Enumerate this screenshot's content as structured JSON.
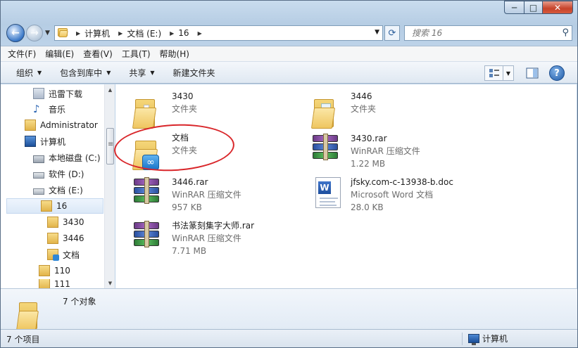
{
  "window": {
    "minimize": "─",
    "maximize": "□",
    "close": "✕"
  },
  "nav": {
    "back": "←",
    "forward": "→",
    "address": [
      "计算机",
      "文档 (E:)",
      "16"
    ],
    "search_placeholder": "搜索 16"
  },
  "menu": [
    "文件(F)",
    "编辑(E)",
    "查看(V)",
    "工具(T)",
    "帮助(H)"
  ],
  "commands": {
    "organize": "组织",
    "include_library": "包含到库中",
    "share": "共享",
    "new_folder": "新建文件夹",
    "help": "?"
  },
  "tree": [
    {
      "label": "迅雷下载",
      "icon": "download-icon"
    },
    {
      "label": "音乐",
      "icon": "music-icon"
    },
    {
      "label": "Administrator",
      "icon": "user-folder-icon"
    },
    {
      "label": "计算机",
      "icon": "computer-icon"
    },
    {
      "label": "本地磁盘 (C:)",
      "icon": "system-drive-icon"
    },
    {
      "label": "软件 (D:)",
      "icon": "drive-icon"
    },
    {
      "label": "文档 (E:)",
      "icon": "drive-icon"
    },
    {
      "label": "16",
      "icon": "folder-icon"
    },
    {
      "label": "3430",
      "icon": "folder-icon"
    },
    {
      "label": "3446",
      "icon": "folder-icon"
    },
    {
      "label": "文档",
      "icon": "cloud-folder-icon"
    },
    {
      "label": "110",
      "icon": "folder-icon"
    },
    {
      "label": "111",
      "icon": "folder-icon"
    }
  ],
  "files": [
    {
      "name": "3430",
      "line2": "文件夹",
      "line3": "",
      "icon": "folder-icon"
    },
    {
      "name": "3446",
      "line2": "文件夹",
      "line3": "",
      "icon": "folder-icon"
    },
    {
      "name": "文档",
      "line2": "文件夹",
      "line3": "",
      "icon": "cloud-folder-icon"
    },
    {
      "name": "3430.rar",
      "line2": "WinRAR 压缩文件",
      "line3": "1.22 MB",
      "icon": "winrar-icon"
    },
    {
      "name": "3446.rar",
      "line2": "WinRAR 压缩文件",
      "line3": "957 KB",
      "icon": "winrar-icon"
    },
    {
      "name": "jfsky.com-c-13938-b.doc",
      "line2": "Microsoft Word 文档",
      "line3": "28.0 KB",
      "icon": "word-doc-icon"
    },
    {
      "name": "书法篆刻集字大师.rar",
      "line2": "WinRAR 压缩文件",
      "line3": "7.71 MB",
      "icon": "winrar-icon"
    }
  ],
  "details": {
    "count": "7 个对象"
  },
  "status": {
    "items": "7 个项目",
    "location": "计算机"
  }
}
